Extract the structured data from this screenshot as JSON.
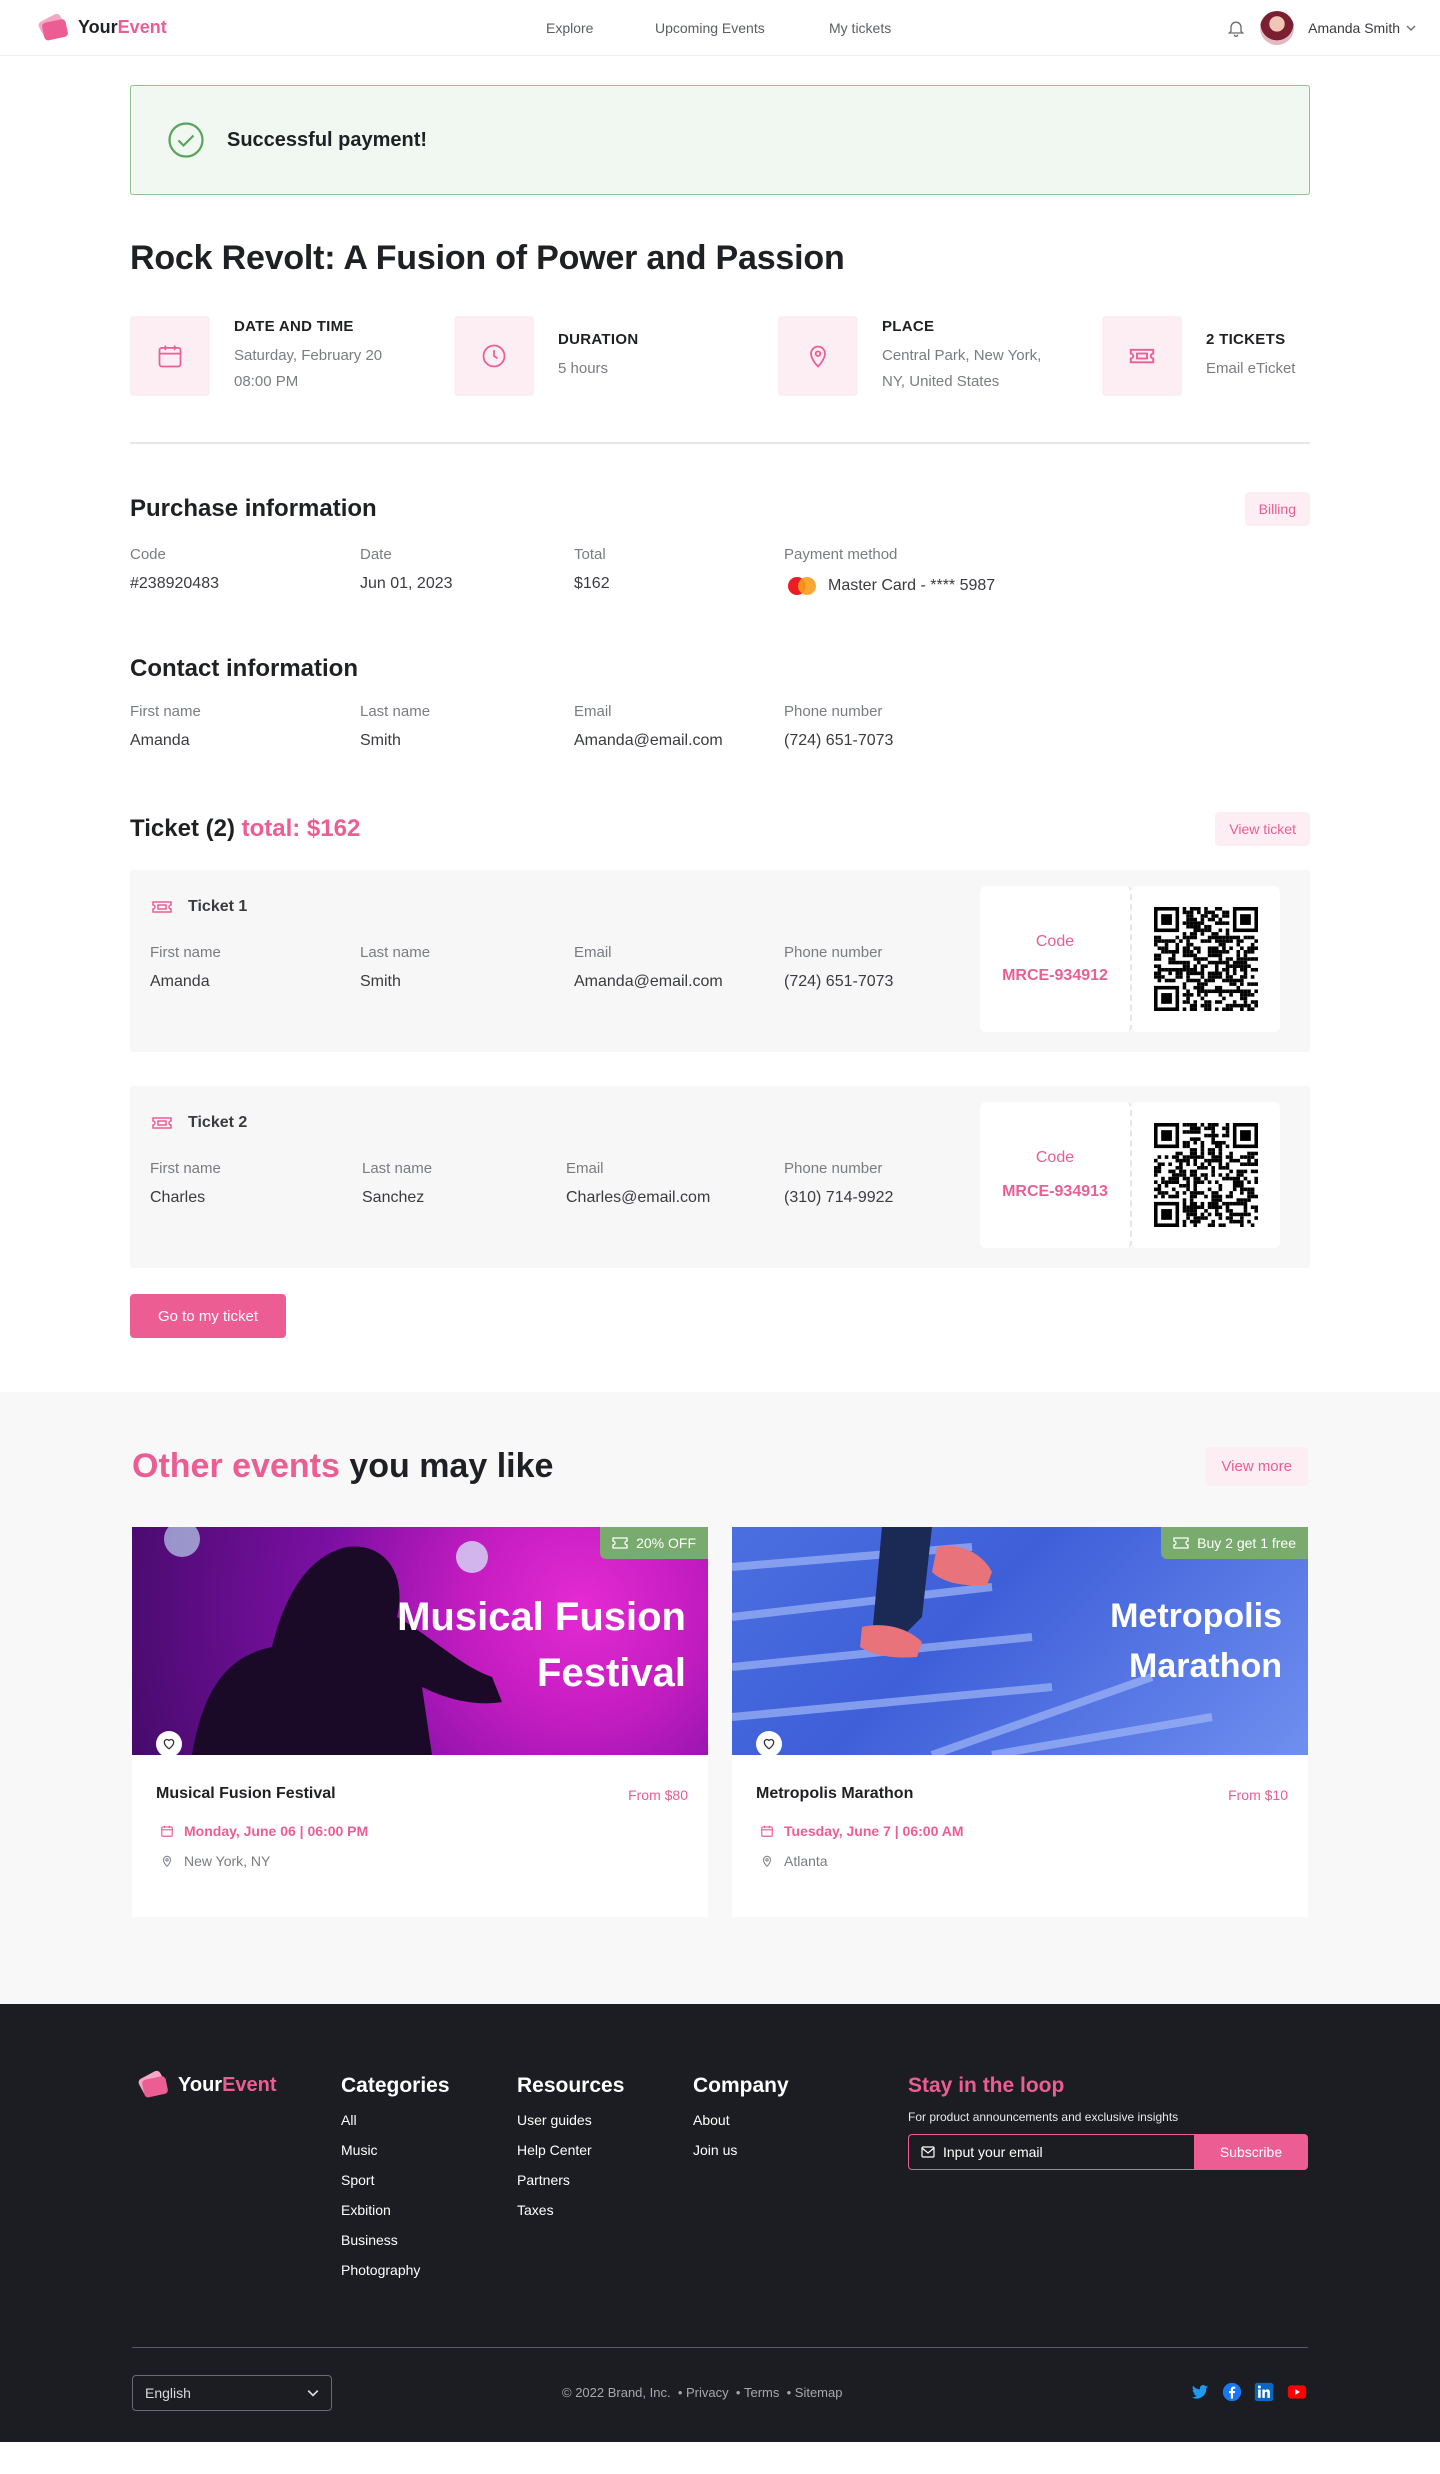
{
  "header": {
    "logo_prefix": "Your",
    "logo_accent": "Event",
    "nav": [
      "Explore",
      "Upcoming Events",
      "My tickets"
    ],
    "user_name": "Amanda Smith"
  },
  "success": {
    "message": "Successful payment!"
  },
  "event": {
    "title": "Rock Revolt: A Fusion of Power and Passion",
    "info": [
      {
        "label": "DATE AND TIME",
        "sub": "Saturday, February 20\n08:00 PM",
        "icon": "calendar-icon"
      },
      {
        "label": "DURATION",
        "sub": "5 hours",
        "icon": "clock-icon"
      },
      {
        "label": "PLACE",
        "sub": "Central Park, New York,\nNY, United States",
        "icon": "map-pin-icon"
      },
      {
        "label": "2 TICKETS",
        "sub": "Email eTicket",
        "icon": "ticket-icon"
      }
    ]
  },
  "purchase": {
    "title": "Purchase information",
    "billing_label": "Billing",
    "code_label": "Code",
    "code_value": "#238920483",
    "date_label": "Date",
    "date_value": "Jun 01, 2023",
    "total_label": "Total",
    "total_value": "$162",
    "payment_label": "Payment method",
    "payment_value": "Master Card - **** 5987"
  },
  "contact": {
    "title": "Contact information",
    "first_label": "First name",
    "first_value": "Amanda",
    "last_label": "Last name",
    "last_value": "Smith",
    "email_label": "Email",
    "email_value": "Amanda@email.com",
    "phone_label": "Phone number",
    "phone_value": "(724) 651-7073"
  },
  "tickets": {
    "title": "Ticket (2)",
    "total": "total: $162",
    "view_label": "View ticket",
    "items": [
      {
        "name": "Ticket 1",
        "first_label": "First name",
        "first": "Amanda",
        "last_label": "Last name",
        "last": "Smith",
        "email_label": "Email",
        "email": "Amanda@email.com",
        "phone_label": "Phone number",
        "phone": "(724) 651-7073",
        "code_label": "Code",
        "code": "MRCE-934912"
      },
      {
        "name": "Ticket 2",
        "first_label": "First name",
        "first": "Charles",
        "last_label": "Last name",
        "last": "Sanchez",
        "email_label": "Email",
        "email": "Charles@email.com",
        "phone_label": "Phone number",
        "phone": "(310) 714-9922",
        "code_label": "Code",
        "code": "MRCE-934913"
      }
    ],
    "go_button": "Go to my ticket"
  },
  "others": {
    "title_accent": "Other events",
    "title_rest": "you may like",
    "view_more": "View more",
    "events": [
      {
        "promo": "20% OFF",
        "banner_line1": "Musical Fusion",
        "banner_line2": "Festival",
        "name": "Musical Fusion Festival",
        "price": "From $80",
        "date": "Monday, June 06 | 06:00 PM",
        "location": "New York, NY"
      },
      {
        "promo": "Buy 2 get 1 free",
        "banner_line1": "Metropolis",
        "banner_line2": "Marathon",
        "name": "Metropolis Marathon",
        "price": "From $10",
        "date": "Tuesday, June 7 | 06:00 AM",
        "location": "Atlanta"
      }
    ]
  },
  "footer": {
    "logo_prefix": "Your",
    "logo_accent": "Event",
    "categories": {
      "title": "Categories",
      "items": [
        "All",
        "Music",
        "Sport",
        "Exbition",
        "Business",
        "Photography"
      ]
    },
    "resources": {
      "title": "Resources",
      "items": [
        "User guides",
        "Help Center",
        "Partners",
        "Taxes"
      ]
    },
    "company": {
      "title": "Company",
      "items": [
        "About",
        "Join us"
      ]
    },
    "newsletter": {
      "title": "Stay in the loop",
      "subtitle": "For product announcements and exclusive insights",
      "placeholder": "Input your email",
      "button": "Subscribe"
    },
    "language": "English",
    "copyright": "© 2022 Brand, Inc.",
    "links": [
      "Privacy",
      "Terms",
      "Sitemap"
    ]
  },
  "colors": {
    "accent": "#ec5d94",
    "success_border": "#8fc28f",
    "promo": "#7aab6e",
    "footer_bg": "#1b1d22"
  }
}
